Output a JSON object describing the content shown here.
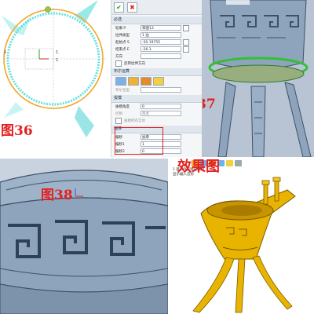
{
  "figures": {
    "fig36": "图36",
    "fig37": "图37",
    "fig38": "图38",
    "result": "效果图"
  },
  "sketch": {
    "labels": [
      "1",
      "1",
      "1"
    ]
  },
  "dialog": {
    "ok_icon": "check-icon",
    "cancel_icon": "close-icon",
    "section_required": "必选",
    "profile_label": "轮廓 P",
    "profile_value": "草图13",
    "mode_label": "拉伸类型",
    "mode_value": "1 边",
    "start_label": "起始点 S",
    "start_value": "-50.19755",
    "end_label": "结束点 E",
    "end_value": "-26.1",
    "dir_label": "方向",
    "reverse_label": "反转拉伸方向",
    "section_boolean": "布尔运算",
    "boolean_target_label": "布尔造型",
    "section_draft": "拔模",
    "draft_angle_label": "拔模角度",
    "draft_angle_value": "0",
    "draft_ref_label": "控制",
    "draft_ref_value": "两者",
    "draft_check_label": "拔模所有实体",
    "section_offset": "偏移",
    "offset_label": "偏移",
    "offset_value": "加厚",
    "offset1_label": "偏移1",
    "offset1_value": "1",
    "offset2_label": "偏移2",
    "offset2_value": "0"
  },
  "effect": {
    "tree_line1": "1 基于外形特征建模",
    "tree_line2": "显示编入造形"
  },
  "colors": {
    "accent_red": "#e32020",
    "sketch_orange": "#f5a623",
    "sketch_cyan": "#3fd8d8",
    "model_gold": "#e8b400",
    "model_steel": "#8ea4bc"
  }
}
